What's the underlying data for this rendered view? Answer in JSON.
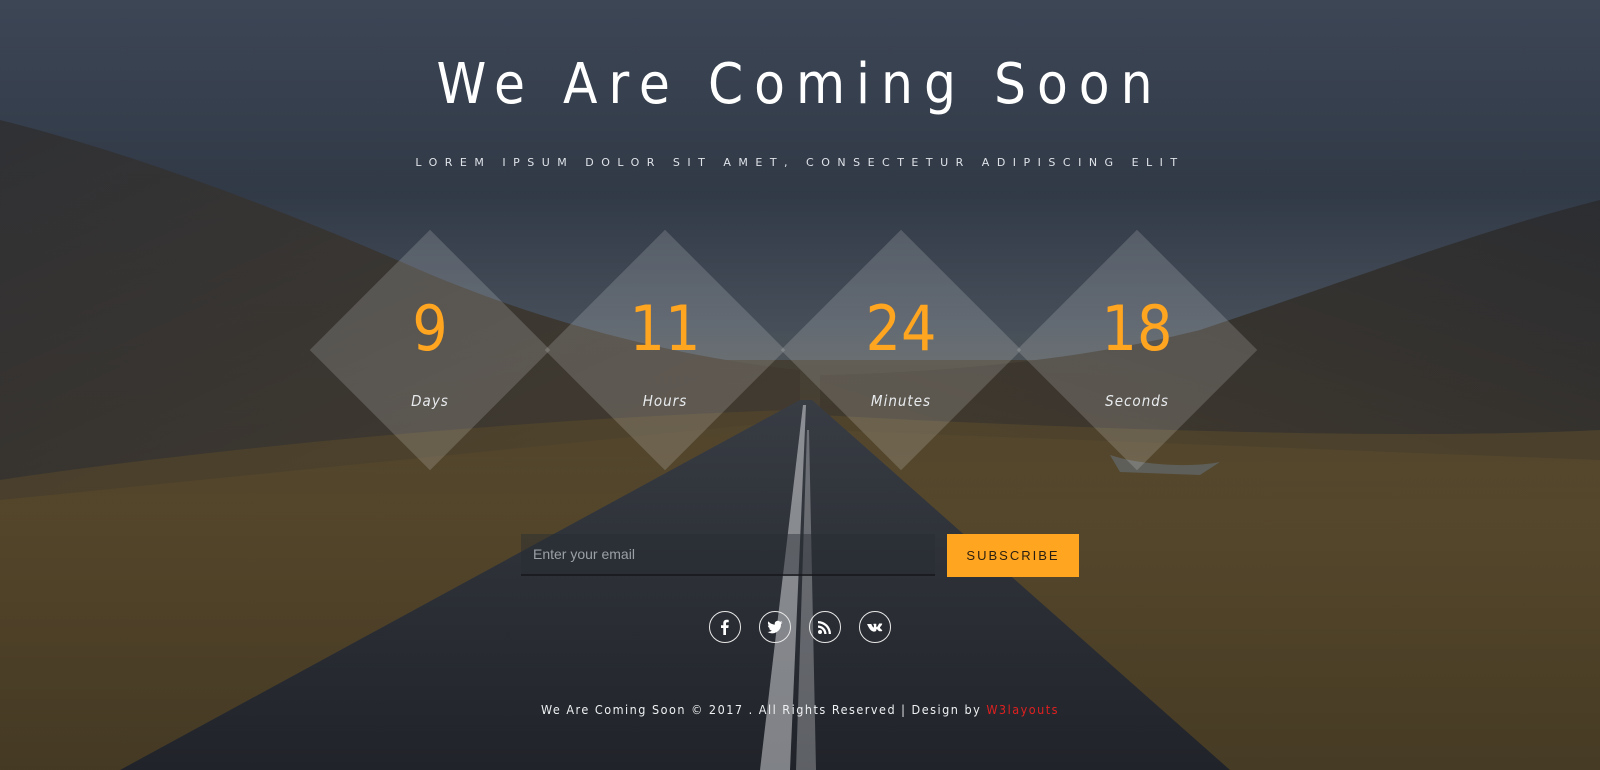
{
  "page": {
    "title": "We Are Coming Soon",
    "subtitle": "LOREM IPSUM DOLOR SIT AMET, CONSECTETUR ADIPISCING ELIT"
  },
  "countdown": [
    {
      "value": "9",
      "unit": "Days"
    },
    {
      "value": "11",
      "unit": "Hours"
    },
    {
      "value": "24",
      "unit": "Minutes"
    },
    {
      "value": "18",
      "unit": "Seconds"
    }
  ],
  "subscribe": {
    "placeholder": "Enter your email",
    "value": "",
    "button_label": "SUBSCRIBE"
  },
  "social": [
    {
      "icon": "facebook-icon"
    },
    {
      "icon": "twitter-icon"
    },
    {
      "icon": "rss-icon"
    },
    {
      "icon": "vk-icon"
    }
  ],
  "footer": {
    "text": "We Are Coming Soon © 2017 . All Rights Reserved | Design by ",
    "credit": "W3layouts"
  },
  "colors": {
    "accent": "#ffa51f",
    "credit": "#e02020"
  }
}
